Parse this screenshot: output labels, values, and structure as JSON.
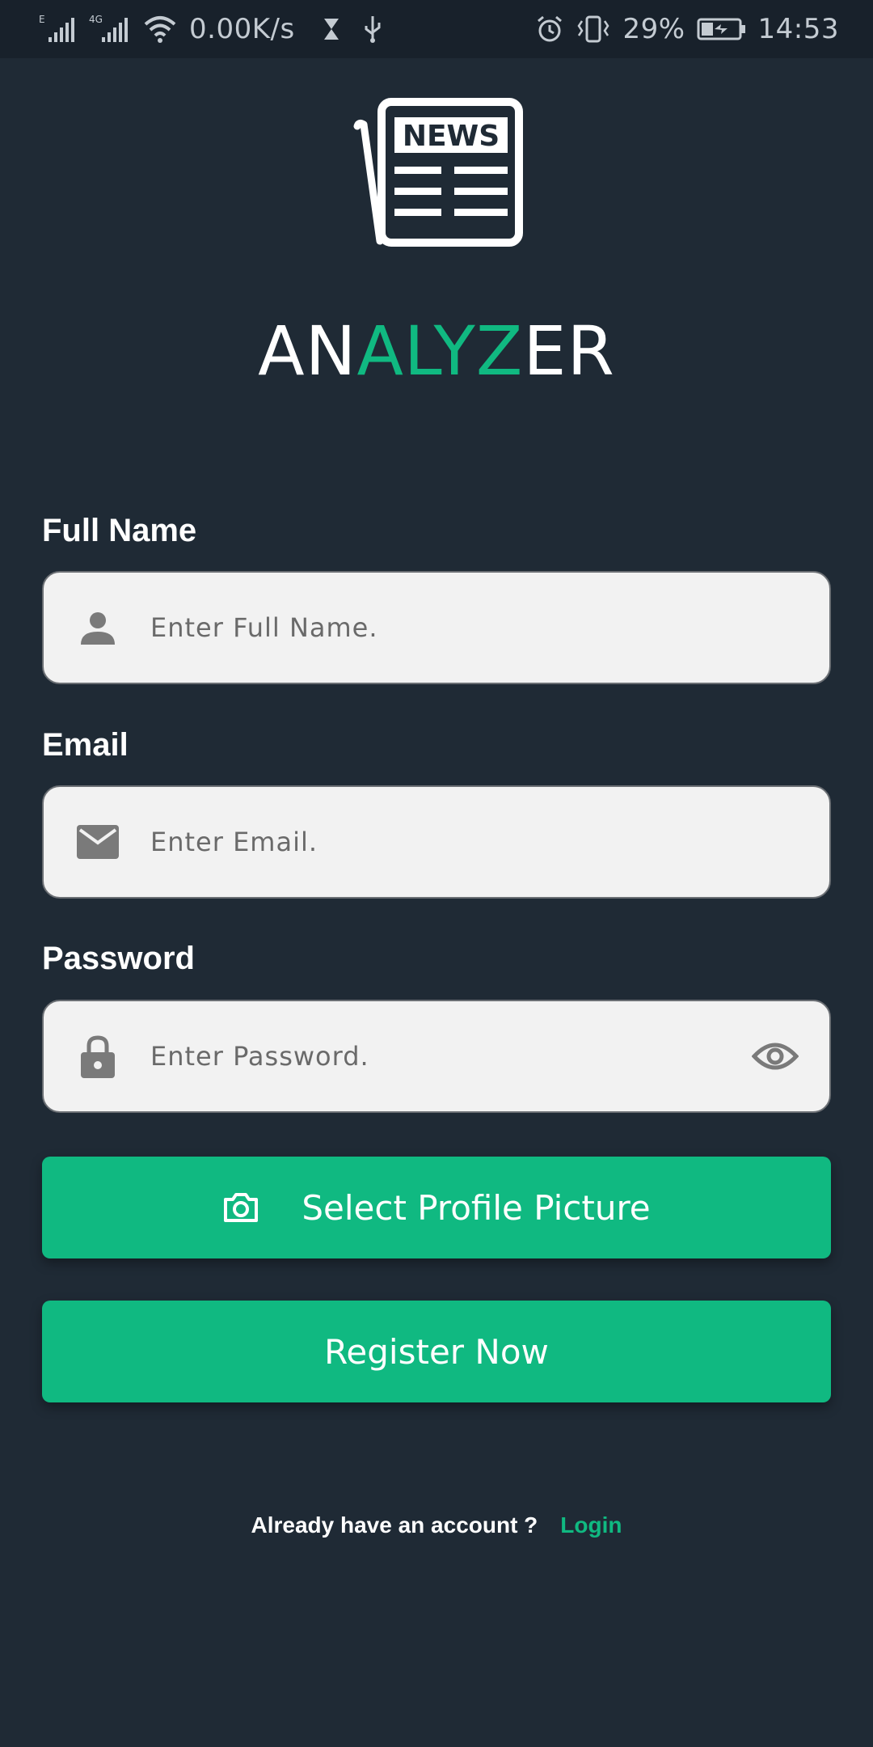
{
  "status_bar": {
    "network_left": "E",
    "network_right": "4G",
    "speed": "0.00K/s",
    "battery": "29%",
    "time": "14:53"
  },
  "app": {
    "logo_text": "NEWS",
    "title_part1": "AN",
    "title_part2": "ALYZ",
    "title_part3": "ER",
    "accent_color": "#10b981"
  },
  "form": {
    "full_name": {
      "label": "Full Name",
      "placeholder": "Enter Full Name.",
      "icon": "person-icon"
    },
    "email": {
      "label": "Email",
      "placeholder": "Enter Email.",
      "icon": "mail-icon"
    },
    "password": {
      "label": "Password",
      "placeholder": "Enter Password.",
      "icon": "lock-icon",
      "toggle_icon": "eye-icon"
    }
  },
  "buttons": {
    "select_picture": "Select Profile Picture",
    "register": "Register Now"
  },
  "footer": {
    "question": "Already have an account ?",
    "login": "Login"
  }
}
